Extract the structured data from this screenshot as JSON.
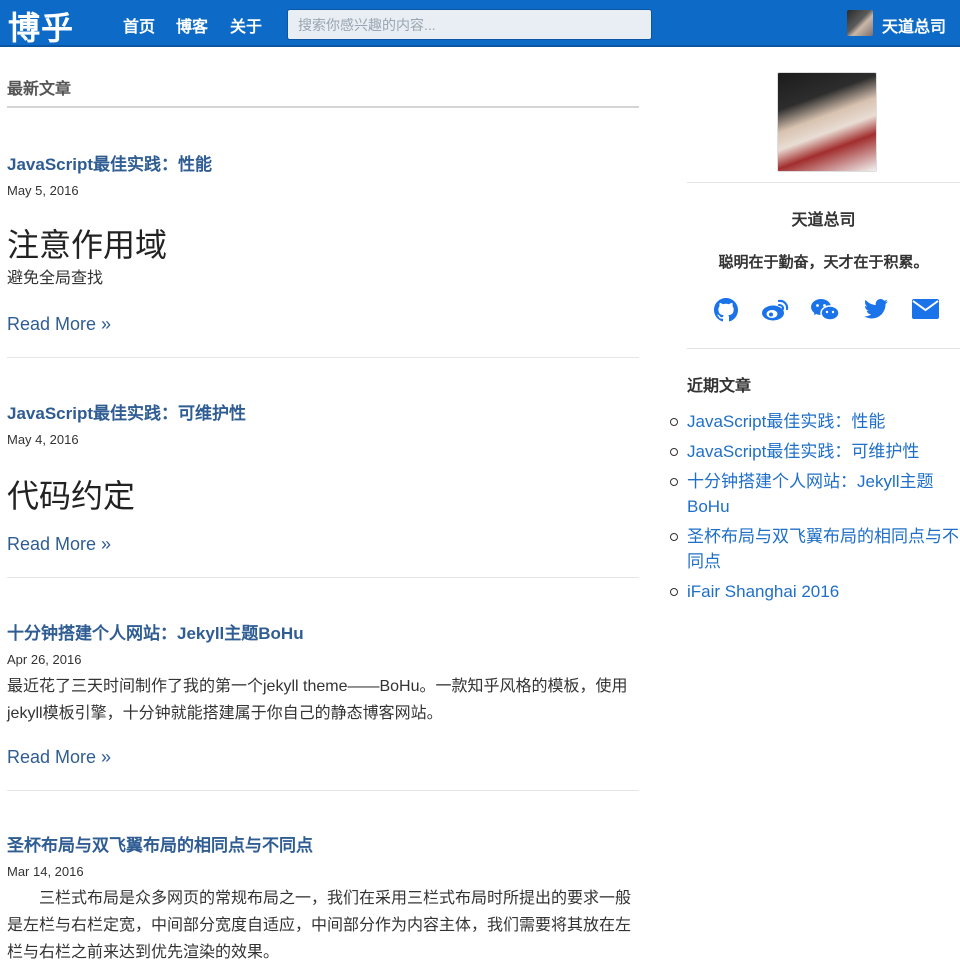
{
  "navbar": {
    "logo": "博乎",
    "links": [
      "首页",
      "博客",
      "关于"
    ],
    "search_placeholder": "搜索你感兴趣的内容...",
    "user_name": "天道总司"
  },
  "main": {
    "section_title": "最新文章",
    "posts": [
      {
        "title": "JavaScript最佳实践：性能",
        "date": "May 5, 2016",
        "heading": "注意作用域",
        "excerpt": "避免全局查找",
        "read_more": "Read More »"
      },
      {
        "title": "JavaScript最佳实践：可维护性",
        "date": "May 4, 2016",
        "heading": "代码约定",
        "read_more": "Read More »"
      },
      {
        "title": "十分钟搭建个人网站：Jekyll主题BoHu",
        "date": "Apr 26, 2016",
        "excerpt": "最近花了三天时间制作了我的第一个jekyll theme——BoHu。一款知乎风格的模板，使用jekyll模板引擎，十分钟就能搭建属于你自己的静态博客网站。",
        "read_more": "Read More »"
      },
      {
        "title": "圣杯布局与双飞翼布局的相同点与不同点",
        "date": "Mar 14, 2016",
        "excerpt": "三栏式布局是众多网页的常规布局之一，我们在采用三栏式布局时所提出的要求一般是左栏与右栏定宽，中间部分宽度自适应，中间部分作为内容主体，我们需要将其放在左栏与右栏之前来达到优先渲染的效果。"
      }
    ]
  },
  "sidebar": {
    "name": "天道总司",
    "motto": "聪明在于勤奋，天才在于积累。",
    "social_icons": [
      "github-icon",
      "weibo-icon",
      "wechat-icon",
      "twitter-icon",
      "email-icon"
    ],
    "recent_heading": "近期文章",
    "recent_posts": [
      "JavaScript最佳实践：性能",
      "JavaScript最佳实践：可维护性",
      "十分钟搭建个人网站：Jekyll主题BoHu",
      "圣杯布局与双飞翼布局的相同点与不同点",
      "iFair Shanghai 2016"
    ]
  },
  "colors": {
    "navbar": "#0d6bc7",
    "link": "#2f5d93",
    "accent": "#1a73e8"
  }
}
